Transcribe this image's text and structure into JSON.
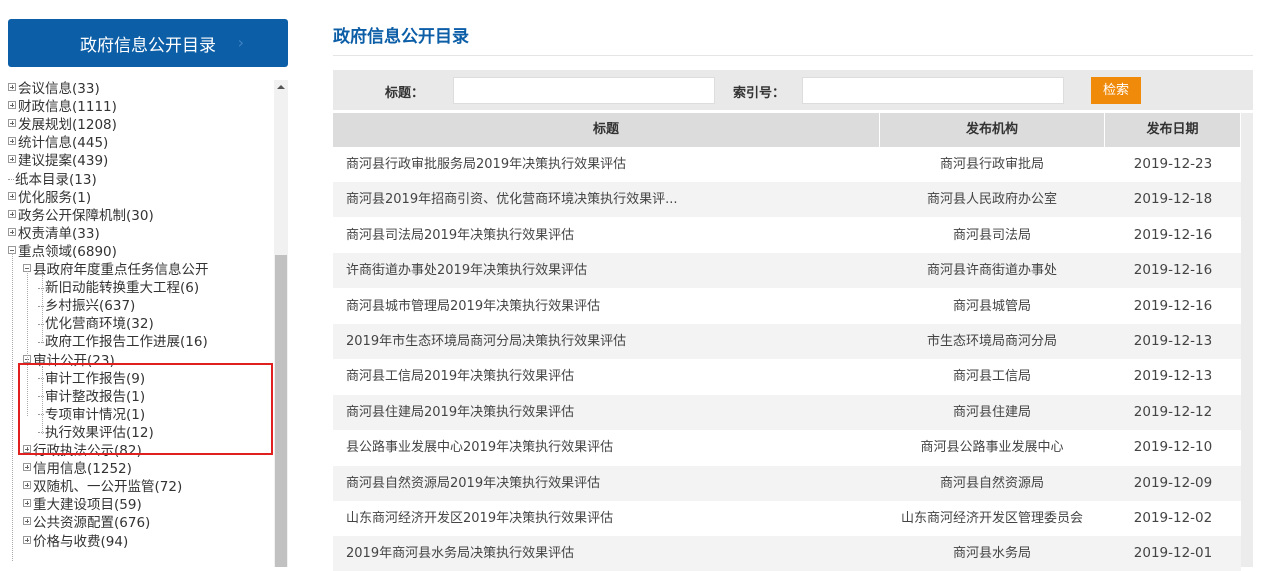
{
  "sidebar": {
    "header": "政府信息公开目录",
    "tree": [
      {
        "label": "会议信息(33)",
        "toggle": "plus"
      },
      {
        "label": "财政信息(1111)",
        "toggle": "plus"
      },
      {
        "label": "发展规划(1208)",
        "toggle": "plus"
      },
      {
        "label": "统计信息(445)",
        "toggle": "plus"
      },
      {
        "label": "建议提案(439)",
        "toggle": "plus"
      },
      {
        "label": "纸本目录(13)",
        "toggle": "none"
      },
      {
        "label": "优化服务(1)",
        "toggle": "plus"
      },
      {
        "label": "政务公开保障机制(30)",
        "toggle": "plus"
      },
      {
        "label": "权责清单(33)",
        "toggle": "plus"
      },
      {
        "label": "重点领域(6890)",
        "toggle": "minus"
      },
      {
        "label": "县政府年度重点任务信息公开",
        "toggle": "minus"
      },
      {
        "label": "新旧动能转换重大工程(6)",
        "toggle": "none"
      },
      {
        "label": "乡村振兴(637)",
        "toggle": "none"
      },
      {
        "label": "优化营商环境(32)",
        "toggle": "none"
      },
      {
        "label": "政府工作报告工作进展(16)",
        "toggle": "none"
      },
      {
        "label": "审计公开(23)",
        "toggle": "minus"
      },
      {
        "label": "审计工作报告(9)",
        "toggle": "none"
      },
      {
        "label": "审计整改报告(1)",
        "toggle": "none"
      },
      {
        "label": "专项审计情况(1)",
        "toggle": "none"
      },
      {
        "label": "执行效果评估(12)",
        "toggle": "none"
      },
      {
        "label": "行政执法公示(82)",
        "toggle": "plus"
      },
      {
        "label": "信用信息(1252)",
        "toggle": "plus"
      },
      {
        "label": "双随机、一公开监管(72)",
        "toggle": "plus"
      },
      {
        "label": "重大建设项目(59)",
        "toggle": "plus"
      },
      {
        "label": "公共资源配置(676)",
        "toggle": "plus"
      },
      {
        "label": "价格与收费(94)",
        "toggle": "plus"
      }
    ]
  },
  "main": {
    "title": "政府信息公开目录",
    "search": {
      "title_label": "标题：",
      "index_label": "索引号：",
      "button": "检索"
    },
    "table": {
      "headers": [
        "标题",
        "发布机构",
        "发布日期"
      ],
      "rows": [
        [
          "商河县行政审批服务局2019年决策执行效果评估",
          "商河县行政审批局",
          "2019-12-23"
        ],
        [
          "商河县2019年招商引资、优化营商环境决策执行效果评...",
          "商河县人民政府办公室",
          "2019-12-18"
        ],
        [
          "商河县司法局2019年决策执行效果评估",
          "商河县司法局",
          "2019-12-16"
        ],
        [
          "许商街道办事处2019年决策执行效果评估",
          "商河县许商街道办事处",
          "2019-12-16"
        ],
        [
          "商河县城市管理局2019年决策执行效果评估",
          "商河县城管局",
          "2019-12-16"
        ],
        [
          "2019年市生态环境局商河分局决策执行效果评估",
          "市生态环境局商河分局",
          "2019-12-13"
        ],
        [
          "商河县工信局2019年决策执行效果评估",
          "商河县工信局",
          "2019-12-13"
        ],
        [
          "商河县住建局2019年决策执行效果评估",
          "商河县住建局",
          "2019-12-12"
        ],
        [
          "县公路事业发展中心2019年决策执行效果评估",
          "商河县公路事业发展中心",
          "2019-12-10"
        ],
        [
          "商河县自然资源局2019年决策执行效果评估",
          "商河县自然资源局",
          "2019-12-09"
        ],
        [
          "山东商河经济开发区2019年决策执行效果评估",
          "山东商河经济开发区管理委员会",
          "2019-12-02"
        ],
        [
          "2019年商河县水务局决策执行效果评估",
          "商河县水务局",
          "2019-12-01"
        ]
      ]
    }
  },
  "colors": {
    "primary": "#0c5ea7",
    "search_button": "#f08a0b",
    "highlight": "#e0201e"
  }
}
